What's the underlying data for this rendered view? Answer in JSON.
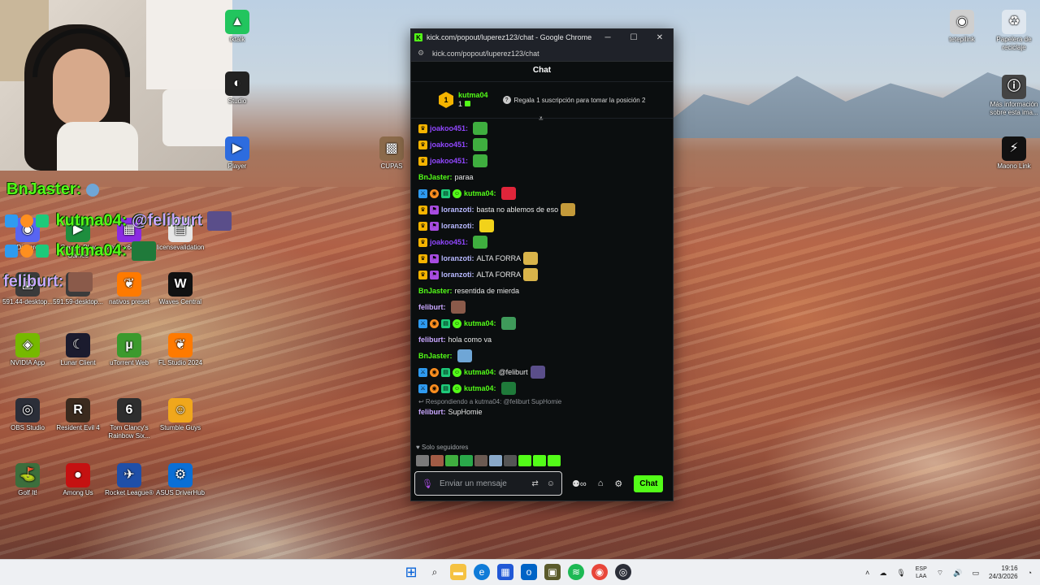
{
  "overlay": {
    "line1_user": "BnJaster",
    "line2_user": "kutma04",
    "line2_text": "@feliburt",
    "line3_user": "kutma04",
    "line4_user": "feliburt"
  },
  "desktop_icons": [
    {
      "label": "Discord",
      "icon": "discord-icon",
      "color": "#5865f2",
      "glyph": "◉"
    },
    {
      "label": "Google Play Games",
      "icon": "play-games-icon",
      "color": "#1e8e3e",
      "glyph": "▶"
    },
    {
      "label": "winrar-x64-713es",
      "icon": "winrar-icon",
      "color": "#8a2be2",
      "glyph": "▦"
    },
    {
      "label": "licensevalidation",
      "icon": "document-icon",
      "color": "#e6e6e6",
      "glyph": "▤"
    },
    {
      "label": "591.44-desktop...",
      "icon": "installer-icon",
      "color": "#3b3b3b",
      "glyph": "▣"
    },
    {
      "label": "591.59-desktop...",
      "icon": "installer-icon",
      "color": "#3b3b3b",
      "glyph": "▣"
    },
    {
      "label": "nativos preset",
      "icon": "fl-studio-icon",
      "color": "#ff7a00",
      "glyph": "❦"
    },
    {
      "label": "Waves Central",
      "icon": "waves-icon",
      "color": "#111111",
      "glyph": "W"
    },
    {
      "label": "NVIDIA App",
      "icon": "nvidia-icon",
      "color": "#76b900",
      "glyph": "◈"
    },
    {
      "label": "Lunar Client",
      "icon": "lunar-icon",
      "color": "#1b1b2e",
      "glyph": "☾"
    },
    {
      "label": "uTorrent Web",
      "icon": "utorrent-icon",
      "color": "#3c9a2d",
      "glyph": "µ"
    },
    {
      "label": "FL Studio 2024",
      "icon": "fl-studio-icon",
      "color": "#ff7a00",
      "glyph": "❦"
    },
    {
      "label": "OBS Studio",
      "icon": "obs-icon",
      "color": "#2b2e38",
      "glyph": "◎"
    },
    {
      "label": "Resident Evil 4",
      "icon": "re4-icon",
      "color": "#3a2a1e",
      "glyph": "R"
    },
    {
      "label": "Tom Clancy's Rainbow Six...",
      "icon": "rainbow-six-icon",
      "color": "#2e2e2e",
      "glyph": "6"
    },
    {
      "label": "Stumble Guys",
      "icon": "stumble-guys-icon",
      "color": "#f0a71c",
      "glyph": "☺"
    },
    {
      "label": "Golf It!",
      "icon": "golf-it-icon",
      "color": "#3c6e3c",
      "glyph": "⛳"
    },
    {
      "label": "Among Us",
      "icon": "among-us-icon",
      "color": "#c51111",
      "glyph": "●"
    },
    {
      "label": "Rocket League®",
      "icon": "rocket-league-icon",
      "color": "#1f4fa8",
      "glyph": "✈"
    },
    {
      "label": "ASUS DriverHub",
      "icon": "asus-icon",
      "color": "#0a6fd6",
      "glyph": "⚙"
    },
    {
      "label": "tktalk",
      "icon": "app-icon",
      "color": "#22c55e",
      "glyph": "▲"
    },
    {
      "label": "Studio",
      "icon": "app-icon",
      "color": "#222222",
      "glyph": "◐"
    },
    {
      "label": "Player",
      "icon": "app-icon",
      "color": "#2d6cdf",
      "glyph": "▶"
    },
    {
      "label": "CUPAS",
      "icon": "folder-image-icon",
      "color": "#8b6a4a",
      "glyph": "▩"
    },
    {
      "label": "tetepilink",
      "icon": "image-icon",
      "color": "#cfcfcf",
      "glyph": "◉"
    },
    {
      "label": "Papelera de reciclaje",
      "icon": "recycle-bin-icon",
      "color": "#dfe7ef",
      "glyph": "♻"
    },
    {
      "label": "Más información sobre esta ima...",
      "icon": "info-icon",
      "color": "#444444",
      "glyph": "ⓘ"
    },
    {
      "label": "Maono Link",
      "icon": "maono-icon",
      "color": "#111111",
      "glyph": "⚡"
    }
  ],
  "window": {
    "title": "kick.com/popout/luperez123/chat - Google Chrome",
    "url": "kick.com/popout/luperez123/chat",
    "minimize": "─",
    "maximize": "☐",
    "close": "✕"
  },
  "chat": {
    "header": "Chat",
    "pinned": {
      "rank": "1",
      "user": "kutma04",
      "count": "1",
      "gift_text": "Regala 1 suscripción para tomar la posición 2"
    },
    "messages": [
      {
        "badges": [
          "crown"
        ],
        "user": "joakoo451:",
        "color": "#9147ff",
        "text": "",
        "emote": "#3fae3f"
      },
      {
        "badges": [
          "crown"
        ],
        "user": "joakoo451:",
        "color": "#9147ff",
        "text": "",
        "emote": "#3fae3f"
      },
      {
        "badges": [
          "crown"
        ],
        "user": "joakoo451:",
        "color": "#9147ff",
        "text": "",
        "emote": "#3fae3f"
      },
      {
        "badges": [],
        "user": "BnJaster:",
        "color": "#53fc18",
        "text": "paraa",
        "emote": ""
      },
      {
        "badges": [
          "blue",
          "orange",
          "green",
          "sub"
        ],
        "user": "kutma04:",
        "color": "#53fc18",
        "text": "",
        "emote": "#e0253a"
      },
      {
        "badges": [
          "crown",
          "purple"
        ],
        "user": "loranzoti:",
        "color": "#b8b9ff",
        "text": "basta no ablemos de eso",
        "emote": "#c49a3a"
      },
      {
        "badges": [
          "crown",
          "purple"
        ],
        "user": "loranzoti:",
        "color": "#b8b9ff",
        "text": "",
        "emote": "#f2d21a"
      },
      {
        "badges": [
          "crown"
        ],
        "user": "joakoo451:",
        "color": "#9147ff",
        "text": "",
        "emote": "#3fae3f"
      },
      {
        "badges": [
          "crown",
          "purple"
        ],
        "user": "loranzoti:",
        "color": "#b8b9ff",
        "text": "ALTA FORRA",
        "emote": "#d9b44a"
      },
      {
        "badges": [
          "crown",
          "purple"
        ],
        "user": "loranzoti:",
        "color": "#b8b9ff",
        "text": "ALTA FORRA",
        "emote": "#d9b44a"
      },
      {
        "badges": [],
        "user": "BnJaster:",
        "color": "#53fc18",
        "text": "resentida de mierda",
        "emote": ""
      },
      {
        "badges": [],
        "user": "feliburt:",
        "color": "#c9a7ff",
        "text": "",
        "emote": "#8a5a4a"
      },
      {
        "badges": [
          "blue",
          "orange",
          "green",
          "sub"
        ],
        "user": "kutma04:",
        "color": "#53fc18",
        "text": "",
        "emote": "#3f9a5a"
      },
      {
        "badges": [],
        "user": "feliburt:",
        "color": "#c9a7ff",
        "text": "hola como va",
        "emote": ""
      },
      {
        "badges": [],
        "user": "BnJaster:",
        "color": "#53fc18",
        "text": "",
        "emote": "#6fa6d6"
      },
      {
        "badges": [
          "blue",
          "orange",
          "green",
          "sub"
        ],
        "user": "kutma04:",
        "color": "#53fc18",
        "text": "@feliburt",
        "emote": "#5a4e8a"
      },
      {
        "badges": [
          "blue",
          "orange",
          "green",
          "sub"
        ],
        "user": "kutma04:",
        "color": "#53fc18",
        "text": "",
        "emote": "#1f7a3a"
      }
    ],
    "reply_hint": "Respondiendo a kutma04: @feliburt SupHomie",
    "last_message": {
      "user": "feliburt:",
      "text": "SupHomie"
    },
    "followers_only": "Solo seguidores",
    "input_placeholder": "Enviar un mensaje",
    "send_button": "Chat"
  },
  "taskbar": {
    "lang_top": "ESP",
    "lang_bottom": "LAA",
    "time": "19:16",
    "date": "24/3/2026"
  }
}
